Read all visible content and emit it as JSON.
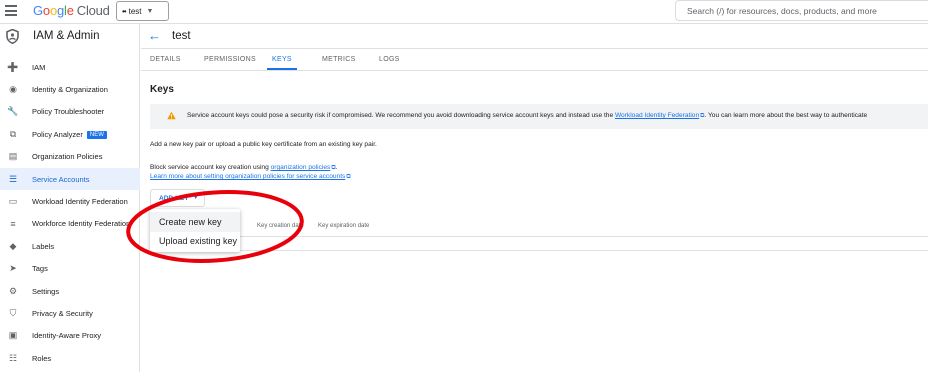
{
  "topbar": {
    "logo_g": "G",
    "logo_o1": "o",
    "logo_o2": "o",
    "logo_g2": "g",
    "logo_l": "l",
    "logo_e": "e",
    "logo_cloud": "Cloud",
    "project": "test",
    "search_placeholder": "Search (/) for resources, docs, products, and more"
  },
  "sidebar": {
    "title": "IAM & Admin",
    "items": [
      {
        "label": "IAM",
        "icon": "person-add-icon"
      },
      {
        "label": "Identity & Organization",
        "icon": "account-circle-icon"
      },
      {
        "label": "Policy Troubleshooter",
        "icon": "wrench-icon"
      },
      {
        "label": "Policy Analyzer",
        "icon": "analyzer-icon",
        "badge": "NEW"
      },
      {
        "label": "Organization Policies",
        "icon": "policy-doc-icon"
      },
      {
        "label": "Service Accounts",
        "icon": "service-account-icon",
        "active": true
      },
      {
        "label": "Workload Identity Federation",
        "icon": "id-card-icon"
      },
      {
        "label": "Workforce Identity Federation",
        "icon": "list-icon"
      },
      {
        "label": "Labels",
        "icon": "label-icon"
      },
      {
        "label": "Tags",
        "icon": "tag-icon"
      },
      {
        "label": "Settings",
        "icon": "gear-icon"
      },
      {
        "label": "Privacy & Security",
        "icon": "shield-icon"
      },
      {
        "label": "Identity-Aware Proxy",
        "icon": "proxy-icon"
      },
      {
        "label": "Roles",
        "icon": "roles-icon"
      }
    ]
  },
  "page": {
    "title": "test",
    "tabs": [
      "DETAILS",
      "PERMISSIONS",
      "KEYS",
      "METRICS",
      "LOGS"
    ],
    "active_tab": "KEYS",
    "section_title": "Keys",
    "warning_pre": "Service account keys could pose a security risk if compromised. We recommend you avoid downloading service account keys and instead use the ",
    "warning_link": "Workload Identity Federation",
    "warning_post": ". You can learn more about the best way to authenticate",
    "intro": "Add a new key pair or upload a public key certificate from an existing key pair.",
    "block_pre": "Block service account key creation using ",
    "block_link": "organization policies",
    "block_post": ".",
    "learn_link": "Learn more about setting organization policies for service accounts",
    "add_key": "ADD KEY",
    "columns": [
      "Key creation date",
      "Key expiration date"
    ]
  },
  "menu": {
    "items": [
      "Create new key",
      "Upload existing key"
    ]
  },
  "colors": {
    "accent": "#1a73e8",
    "active_bg": "#e8f0fe",
    "warning": "#f29900",
    "annotation": "#e8000b"
  }
}
